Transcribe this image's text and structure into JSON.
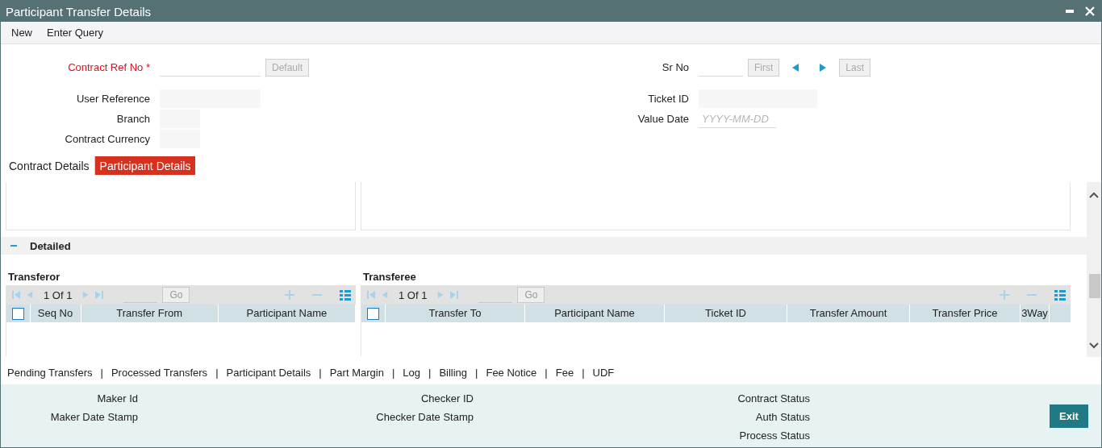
{
  "window": {
    "title": "Participant Transfer Details"
  },
  "menu": [
    "New",
    "Enter Query"
  ],
  "form": {
    "left": [
      {
        "label": "Contract Ref No",
        "required": true,
        "required_mark": "*",
        "disabled": false,
        "button": {
          "label": "Default",
          "disabled": true
        }
      },
      {
        "label": "User Reference",
        "required": false,
        "disabled": true
      },
      {
        "label": "Branch",
        "required": false,
        "disabled": true
      },
      {
        "label": "Contract Currency",
        "required": false,
        "disabled": true
      }
    ],
    "right": [
      {
        "label": "Sr No",
        "disabled": false,
        "nav": {
          "first": {
            "label": "First",
            "disabled": true
          },
          "last": {
            "label": "Last",
            "disabled": true
          }
        }
      },
      {
        "label": "Ticket ID",
        "disabled": true
      },
      {
        "label": "Value Date",
        "disabled": false,
        "placeholder": "YYYY-MM-DD"
      }
    ]
  },
  "tabs": [
    {
      "label": "Contract Details",
      "selected": false
    },
    {
      "label": "Participant Details",
      "selected": true
    }
  ],
  "section": {
    "title": "Detailed",
    "expanded": true
  },
  "grids": [
    {
      "title": "Transferor",
      "pager": "1 Of 1",
      "go": "Go",
      "checked": false,
      "columns": [
        "Seq No",
        "Transfer From",
        "Participant Name"
      ]
    },
    {
      "title": "Transferee",
      "pager": "1 Of 1",
      "go": "Go",
      "checked": false,
      "columns": [
        "Transfer To",
        "Participant Name",
        "Ticket ID",
        "Transfer Amount",
        "Transfer Price",
        "3Way"
      ]
    }
  ],
  "links": [
    {
      "label": "Pending Transfers",
      "separator": "|"
    },
    {
      "label": "Processed Transfers",
      "separator": "|"
    },
    {
      "label": "Participant Details",
      "separator": "|"
    },
    {
      "label": "Part Margin",
      "separator": "|"
    },
    {
      "label": "Log",
      "separator": "|"
    },
    {
      "label": "Billing",
      "separator": "|"
    },
    {
      "label": "Fee Notice",
      "separator": "|"
    },
    {
      "label": "Fee",
      "separator": "|"
    },
    {
      "label": "UDF"
    }
  ],
  "footer": {
    "columns": [
      [
        "Maker Id",
        "Maker Date Stamp"
      ],
      [
        "Checker ID",
        "Checker Date Stamp"
      ],
      [
        "Contract Status",
        "Auth Status",
        "Process Status"
      ]
    ],
    "exit": "Exit"
  }
}
